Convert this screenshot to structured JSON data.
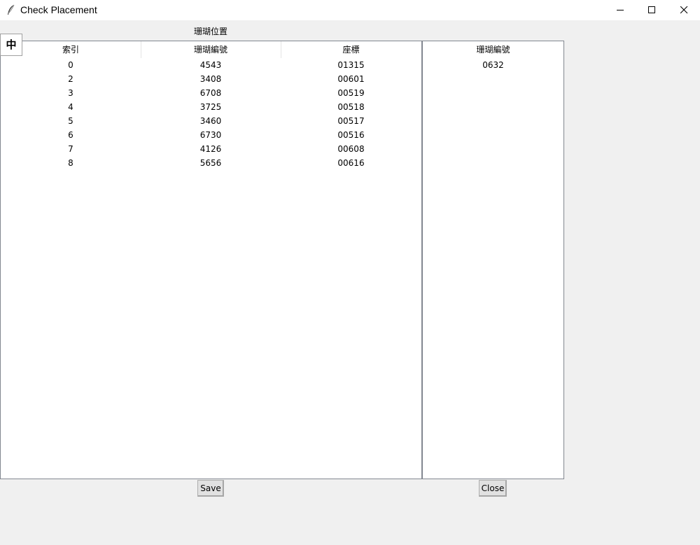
{
  "window": {
    "title": "Check Placement",
    "controls": [
      "minimize-icon",
      "maximize-icon",
      "close-icon"
    ]
  },
  "main_label": "珊瑚位置",
  "lang_button": "中",
  "placement_table": {
    "columns": [
      "索引",
      "珊瑚編號",
      "座標"
    ],
    "rows": [
      {
        "index": "0",
        "coral_id": "4543",
        "coord": "01315"
      },
      {
        "index": "2",
        "coral_id": "3408",
        "coord": "00601"
      },
      {
        "index": "3",
        "coral_id": "6708",
        "coord": "00519"
      },
      {
        "index": "4",
        "coral_id": "3725",
        "coord": "00518"
      },
      {
        "index": "5",
        "coral_id": "3460",
        "coord": "00517"
      },
      {
        "index": "6",
        "coral_id": "6730",
        "coord": "00516"
      },
      {
        "index": "7",
        "coral_id": "4126",
        "coord": "00608"
      },
      {
        "index": "8",
        "coral_id": "5656",
        "coord": "00616"
      }
    ]
  },
  "side_table": {
    "columns": [
      "珊瑚編號"
    ],
    "rows": [
      {
        "coral_id": "0632"
      }
    ]
  },
  "buttons": {
    "save": "Save",
    "close": "Close"
  },
  "colors": {
    "window_bg": "#f0f0f0",
    "tree_bg": "#ffffff",
    "button_bg": "#e1e1e1",
    "border": "#828790"
  }
}
